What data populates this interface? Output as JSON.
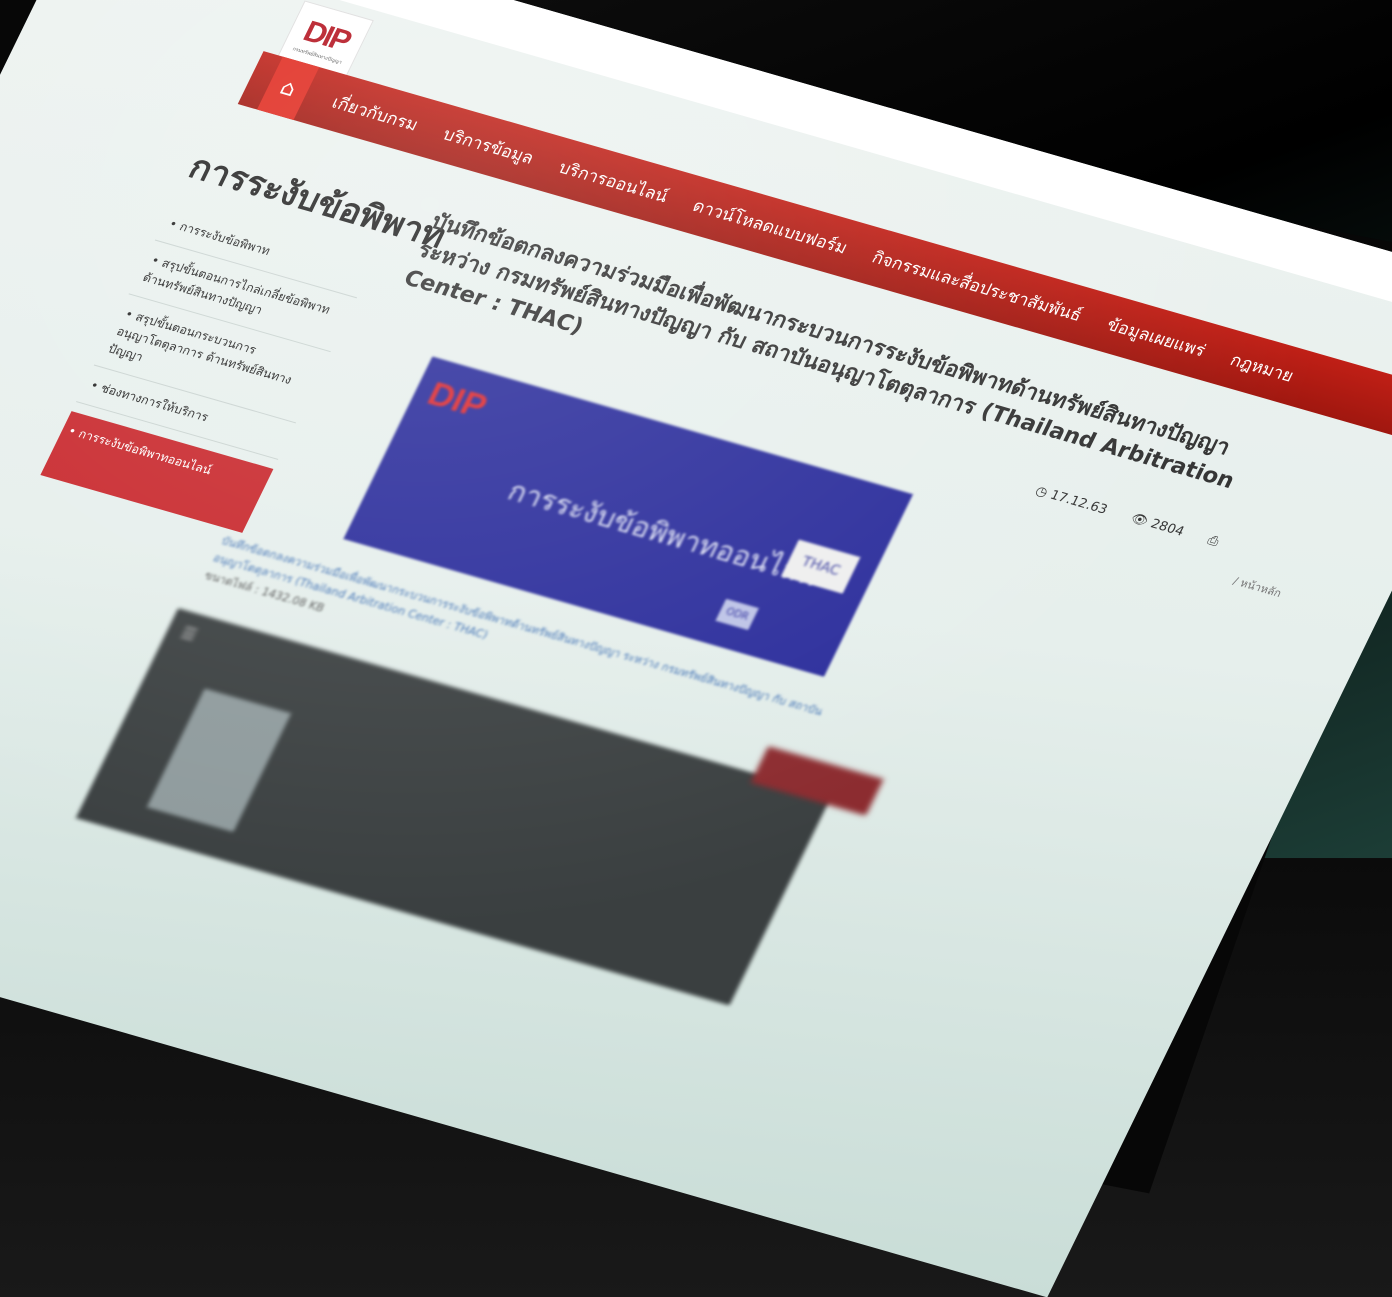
{
  "logo": {
    "mark": "DIP",
    "subtitle": "กรมทรัพย์สินทางปัญญา"
  },
  "nav": {
    "home_icon": "home-icon",
    "items": [
      "เกี่ยวกับกรม",
      "บริการข้อมูล",
      "บริการออนไลน์",
      "ดาวน์โหลดแบบฟอร์ม",
      "กิจกรรมและสื่อประชาสัมพันธ์",
      "ข้อมูลเผยแพร่",
      "กฎหมาย"
    ]
  },
  "sidebar": {
    "title": "การระงับข้อพิพาท",
    "items": [
      "• การระงับข้อพิพาท",
      "• สรุปขั้นตอนการไกล่เกลี่ยข้อพิพาทด้านทรัพย์สินทางปัญญา",
      "• สรุปขั้นตอนกระบวนการอนุญาโตตุลาการ ด้านทรัพย์สินทางปัญญา",
      "• ช่องทางการให้บริการ",
      "• การระงับข้อพิพาทออนไลน์"
    ]
  },
  "breadcrumb": "/ หน้าหลัก",
  "article": {
    "title": "บันทึกข้อตกลงความร่วมมือเพื่อพัฒนากระบวนการระงับข้อพิพาทด้านทรัพย์สินทางปัญญา ระหว่าง กรมทรัพย์สินทางปัญญา กับ สถาบันอนุญาโตตุลาการ (Thailand Arbitration Center : THAC)",
    "date": "17.12.63",
    "views": "2804",
    "print_icon": "print-icon"
  },
  "banner": {
    "logo": "DIP",
    "text": "การระงับข้อพิพาทออนไลน์",
    "partner": "THAC",
    "badge": "ODR"
  },
  "attachment": {
    "link": "บันทึกข้อตกลงความร่วมมือเพื่อพัฒนากระบวนการระงับข้อพิพาทด้านทรัพย์สินทางปัญญา ระหว่าง กรมทรัพย์สินทางปัญญา กับ สถาบันอนุญาโตตุลาการ (Thailand Arbitration Center : THAC)",
    "size": "ขนาดไฟล์ : 1432.08 KB"
  },
  "colors": {
    "nav": "#b81a12",
    "active": "#c8262b",
    "banner": "#2a2c9b"
  }
}
